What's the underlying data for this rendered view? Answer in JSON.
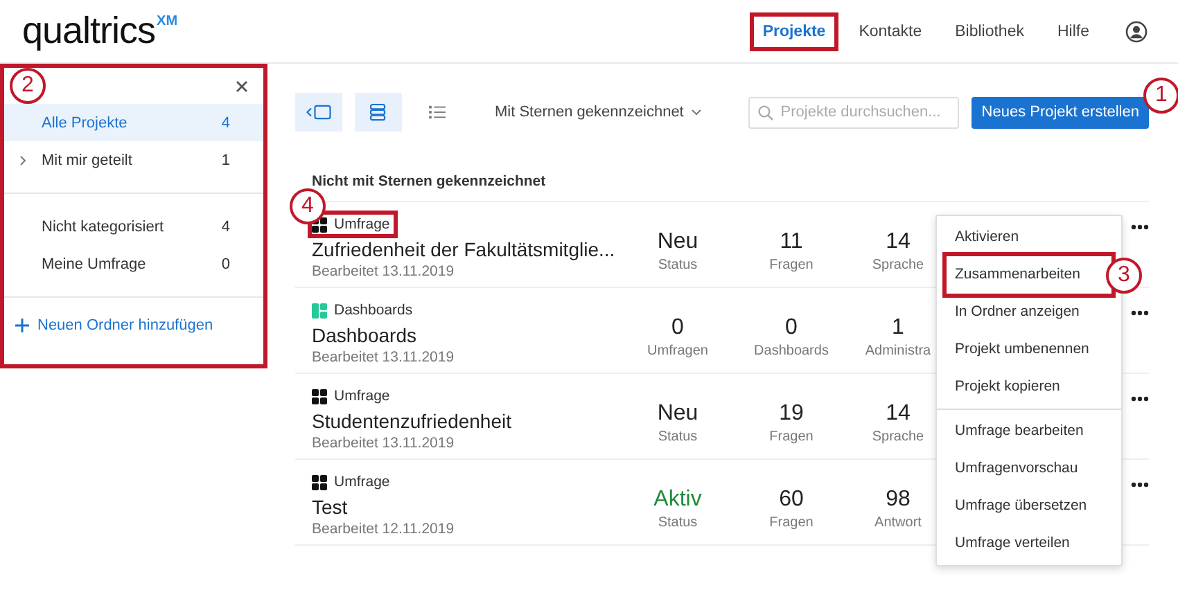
{
  "header": {
    "logo": "qualtrics",
    "logo_mark": "XM",
    "nav": [
      {
        "label": "Projekte",
        "selected": true,
        "highlighted": true
      },
      {
        "label": "Kontakte",
        "selected": false,
        "highlighted": false
      },
      {
        "label": "Bibliothek",
        "selected": false,
        "highlighted": false
      },
      {
        "label": "Hilfe",
        "selected": false,
        "highlighted": false
      }
    ]
  },
  "sidebar": {
    "highlighted": true,
    "folder_groups": [
      {
        "items": [
          {
            "label": "Alle Projekte",
            "count": "4",
            "selected": true,
            "expandable": false
          },
          {
            "label": "Mit mir geteilt",
            "count": "1",
            "selected": false,
            "expandable": true
          }
        ]
      },
      {
        "items": [
          {
            "label": "Nicht kategorisiert",
            "count": "4",
            "selected": false,
            "expandable": false
          },
          {
            "label": "Meine Umfrage",
            "count": "0",
            "selected": false,
            "expandable": false
          }
        ]
      }
    ],
    "add_folder": "Neuen Ordner hinzufügen"
  },
  "toolbar": {
    "view_buttons": [
      {
        "kind": "folders",
        "selected": true
      },
      {
        "kind": "cards",
        "selected": true
      },
      {
        "kind": "list",
        "selected": false
      }
    ],
    "filter": "Mit Sternen gekennzeichnet",
    "search": {
      "placeholder": "Projekte durchsuchen..."
    },
    "create_button": "Neues Projekt erstellen"
  },
  "section_title": "Nicht mit Sternen gekennzeichnet",
  "projects": [
    {
      "kind": "survey",
      "type_label": "Umfrage",
      "type_highlighted": true,
      "name": "Zufriedenheit der Fakultätsmitglie...",
      "edited": "Bearbeitet 13.11.2019",
      "active": false,
      "stats": [
        {
          "value": "Neu",
          "label": "Status"
        },
        {
          "value": "11",
          "label": "Fragen"
        },
        {
          "value": "14",
          "label": "Sprache"
        }
      ]
    },
    {
      "kind": "dashboard",
      "type_label": "Dashboards",
      "type_highlighted": false,
      "name": "Dashboards",
      "edited": "Bearbeitet 13.11.2019",
      "active": false,
      "stats": [
        {
          "value": "0",
          "label": "Umfragen"
        },
        {
          "value": "0",
          "label": "Dashboards"
        },
        {
          "value": "1",
          "label": "Administra"
        }
      ]
    },
    {
      "kind": "survey",
      "type_label": "Umfrage",
      "type_highlighted": false,
      "name": "Studentenzufriedenheit",
      "edited": "Bearbeitet 13.11.2019",
      "active": false,
      "stats": [
        {
          "value": "Neu",
          "label": "Status"
        },
        {
          "value": "19",
          "label": "Fragen"
        },
        {
          "value": "14",
          "label": "Sprache"
        }
      ]
    },
    {
      "kind": "survey",
      "type_label": "Umfrage",
      "type_highlighted": false,
      "name": "Test",
      "edited": "Bearbeitet 12.11.2019",
      "active": true,
      "stats": [
        {
          "value": "Aktiv",
          "label": "Status"
        },
        {
          "value": "60",
          "label": "Fragen"
        },
        {
          "value": "98",
          "label": "Antwort"
        }
      ]
    }
  ],
  "context_menu": {
    "groups": [
      {
        "items": [
          {
            "label": "Aktivieren",
            "highlighted": false
          },
          {
            "label": "Zusammenarbeiten",
            "highlighted": true
          },
          {
            "label": "In Ordner anzeigen",
            "highlighted": false
          },
          {
            "label": "Projekt umbenennen",
            "highlighted": false
          },
          {
            "label": "Projekt kopieren",
            "highlighted": false
          }
        ]
      },
      {
        "items": [
          {
            "label": "Umfrage bearbeiten",
            "highlighted": false
          },
          {
            "label": "Umfragenvorschau",
            "highlighted": false
          },
          {
            "label": "Umfrage übersetzen",
            "highlighted": false
          },
          {
            "label": "Umfrage verteilen",
            "highlighted": false
          }
        ]
      }
    ]
  },
  "callouts": [
    {
      "number": "1"
    },
    {
      "number": "2"
    },
    {
      "number": "3"
    },
    {
      "number": "4"
    }
  ]
}
